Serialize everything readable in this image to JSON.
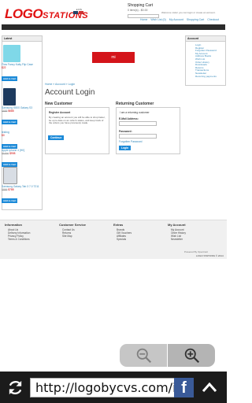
{
  "header": {
    "logo_main": "LOGO",
    "logo_small": "STATIONS",
    "currency": "£ € $",
    "cart_title": "Shopping Cart",
    "cart_items": "0 item(s) - $0.00",
    "welcome": "Welcome visitor you can login or create an account.",
    "top_links": [
      "Home",
      "Wish List (0)",
      "My Account",
      "Shopping Cart",
      "Checkout"
    ]
  },
  "nav": [
    "NEW PHONE",
    "USED PHONE",
    "ACCESSORIES",
    "CASING"
  ],
  "latest": {
    "title": "Latest",
    "products": [
      {
        "name": "Flow Fancy Kaity Flip Case",
        "price": "$22",
        "old_price": "",
        "button": "Add to Cart",
        "color": "#7fd8e8"
      },
      {
        "name": "Samsung i9300 Galaxy S3",
        "price": "$688",
        "old_price": "$699",
        "button": "Add to Cart",
        "color": "#1d3a5e"
      },
      {
        "name": "testing",
        "price": "$0",
        "old_price": "",
        "button": "Add to Cart",
        "color": "#ffffff"
      },
      {
        "name": "Apple iphone 4 [HK]",
        "price": "$998",
        "old_price": "$1000",
        "button": "Add to Cart",
        "color": "#ffffff"
      },
      {
        "name": "Samsung Galaxy Tab 3 7.0 T211",
        "price": "$788",
        "old_price": "$899",
        "button": "Add to Cart",
        "color": "#d8dde4"
      }
    ]
  },
  "account_box": {
    "title": "Account",
    "links": [
      "Login",
      "Register",
      "Forgotten Password",
      "My Account",
      "Address Books",
      "Wish List",
      "Order History",
      "Downloads",
      "Returns",
      "Transactions",
      "Newsletter",
      "Recurring payments"
    ]
  },
  "banner": {
    "text": "mi"
  },
  "main": {
    "breadcrumb": "Home » Account » Login",
    "title": "Account Login",
    "new_customer": {
      "heading": "New Customer",
      "sub": "Register Account",
      "text": "By creating an account you will be able to shop faster, be up to date on an order's status, and keep track of the orders you have previously made.",
      "button": "Continue"
    },
    "returning": {
      "heading": "Returning Customer",
      "sub": "I am a returning customer",
      "email_label": "E-Mail Address:",
      "password_label": "Password:",
      "forgot": "Forgotten Password",
      "button": "Login"
    }
  },
  "footer": {
    "columns": [
      {
        "title": "Information",
        "links": [
          "About Us",
          "Delivery Information",
          "Privacy Policy",
          "Terms & Conditions"
        ]
      },
      {
        "title": "Customer Service",
        "links": [
          "Contact Us",
          "Returns",
          "Site Map"
        ]
      },
      {
        "title": "Extras",
        "links": [
          "Brands",
          "Gift Vouchers",
          "Affiliates",
          "Specials"
        ]
      },
      {
        "title": "My Account",
        "links": [
          "My Account",
          "Order History",
          "Wish List",
          "Newsletter"
        ]
      }
    ],
    "powered": "Powered By OpenCart",
    "copyright": "LOGO STATIONS © 2014"
  },
  "browser": {
    "url": "http://logobycvs.com/index"
  }
}
